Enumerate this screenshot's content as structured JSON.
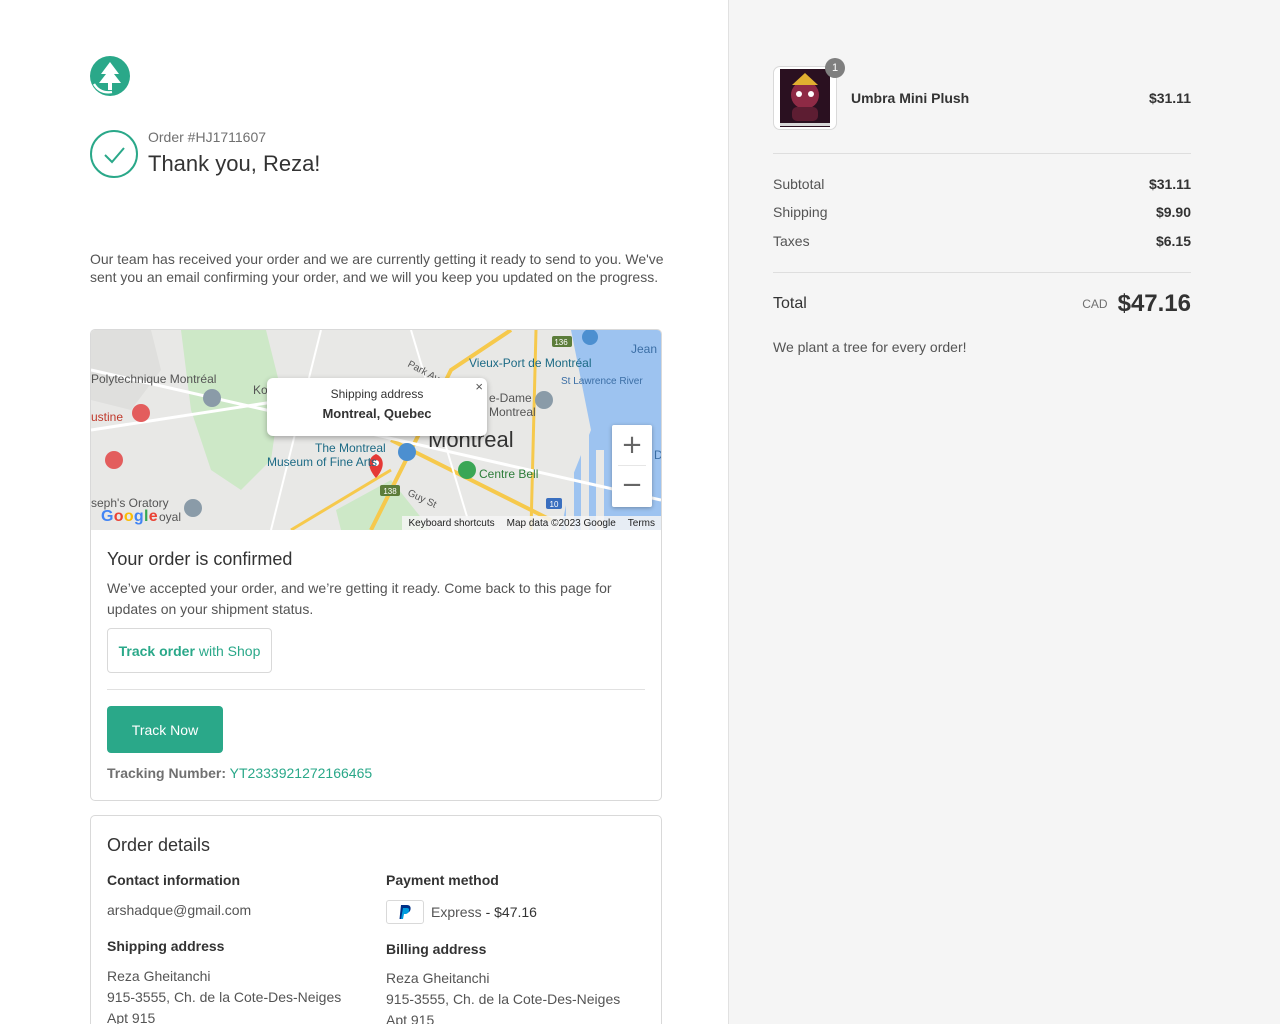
{
  "header": {
    "logo_icon": "tree-icon",
    "order_number": "Order #HJ1711607",
    "thank_you": "Thank you, Reza!"
  },
  "intro_text": "Our team has received your order and we are currently getting it ready to send to you. We've sent you an email confirming your order, and we will you keep you updated on the progress.",
  "map": {
    "popup_label": "Shipping address",
    "popup_city": "Montreal, Quebec",
    "close_glyph": "×",
    "zoom_in": "+",
    "zoom_out": "−",
    "google_letters": [
      "G",
      "o",
      "o",
      "g",
      "l",
      "e"
    ],
    "google_colors": [
      "#4285f4",
      "#ea4335",
      "#fbbc05",
      "#4285f4",
      "#34a853",
      "#ea4335"
    ],
    "footer": {
      "shortcuts": "Keyboard shortcuts",
      "map_data": "Map data ©2023 Google",
      "terms": "Terms"
    },
    "labels": {
      "polytechnique": "Polytechnique Montréal",
      "vieux_port": "Vieux-Port de Montréal",
      "st_lawrence": "St Lawrence River",
      "montreal": "Montreal",
      "museum_1": "The Montreal",
      "museum_2": "Museum of Fine Arts",
      "centre_bell": "Centre Bell",
      "oratory": "seph's Oratory",
      "oratory_2": "oyal",
      "ustine": "ustine",
      "park_ave": "Park Ave",
      "guy_st": "Guy St",
      "notre_dame": "e-Dame",
      "montreal_2": "Montreal",
      "jean": "Jean",
      "ko": "Ko",
      "d": "D",
      "route_136": "136",
      "route_138": "138",
      "route_10": "10"
    }
  },
  "confirmation": {
    "title": "Your order is confirmed",
    "text": "We’ve accepted your order, and we’re getting it ready. Come back to this page for updates on your shipment status.",
    "track_shop_bold": "Track order",
    "track_shop_rest": "with Shop",
    "track_now": "Track Now",
    "tracking_label": "Tracking Number:",
    "tracking_number": "YT2333921272166465"
  },
  "order_details": {
    "title": "Order details",
    "contact_heading": "Contact information",
    "contact_email": "arshadque@gmail.com",
    "payment_heading": "Payment method",
    "payment_method": "Express",
    "payment_amount": "- $47.16",
    "payment_icon": "paypal-icon",
    "shipping_heading": "Shipping address",
    "shipping_lines": [
      "Reza Gheitanchi",
      "915-3555, Ch. de la Cote-Des-Neiges",
      "Apt 915"
    ],
    "billing_heading": "Billing address",
    "billing_lines": [
      "Reza Gheitanchi",
      "915-3555, Ch. de la Cote-Des-Neiges",
      "Apt 915"
    ]
  },
  "summary": {
    "item": {
      "quantity": "1",
      "name": "Umbra Mini Plush",
      "price": "$31.11"
    },
    "subtotal_label": "Subtotal",
    "subtotal": "$31.11",
    "shipping_label": "Shipping",
    "shipping": "$9.90",
    "taxes_label": "Taxes",
    "taxes": "$6.15",
    "total_label": "Total",
    "currency": "CAD",
    "total": "$47.16",
    "tree_note": "We plant a tree for every order!"
  },
  "colors": {
    "accent": "#2aa889",
    "sidebar_bg": "#f5f5f5"
  }
}
